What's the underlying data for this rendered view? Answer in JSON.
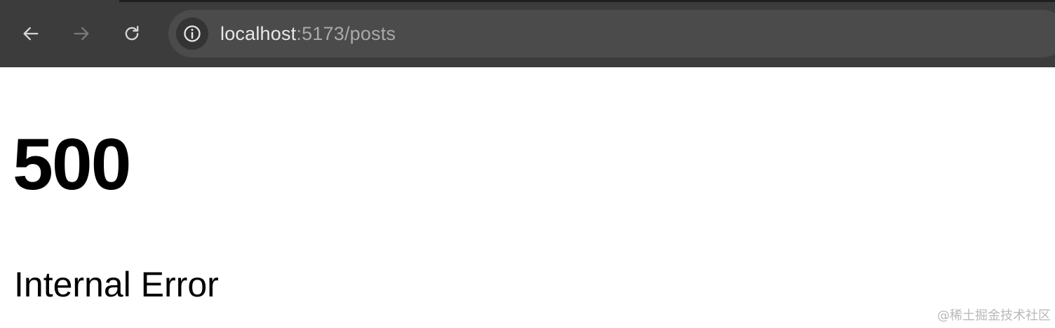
{
  "browser": {
    "url_host": "localhost",
    "url_rest": ":5173/posts",
    "icons": {
      "back": "arrow-left-icon",
      "forward": "arrow-right-icon",
      "reload": "reload-icon",
      "site_info": "info-icon"
    },
    "colors": {
      "toolbar": "#3c3c3c",
      "omnibox": "#4b4b4b"
    }
  },
  "page": {
    "error_code": "500",
    "error_message": "Internal Error"
  },
  "watermark": {
    "text": "@稀土掘金技术社区"
  }
}
